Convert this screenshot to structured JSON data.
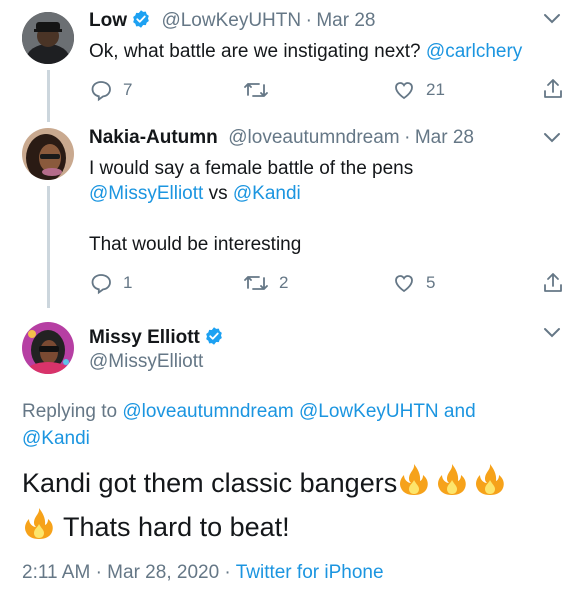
{
  "tweets": [
    {
      "name": "Low",
      "handle": "@LowKeyUHTN",
      "sep": "·",
      "date": "Mar 28",
      "text_prefix": "Ok, what battle are we instigating next? ",
      "mention": "@carlchery",
      "replies": "7",
      "retweets": "",
      "likes": "21"
    },
    {
      "name": "Nakia-Autumn",
      "handle": "@loveautumndream",
      "sep": "·",
      "date": "Mar 28",
      "line1": "I would say a female battle of the pens",
      "mention1": "@MissyElliott",
      "vs": " vs ",
      "mention2": "@Kandi",
      "line3": "That would be interesting",
      "replies": "1",
      "retweets": "2",
      "likes": "5"
    }
  ],
  "main": {
    "name": "Missy Elliott",
    "handle": "@MissyElliott",
    "replying_prefix": "Replying to ",
    "replying_mention1": "@loveautumndream",
    "replying_mention2": "@LowKeyUHTN",
    "replying_and": " and",
    "replying_mention3": "@Kandi",
    "text_line1": "Kandi got them classic bangers",
    "text_line2": "Thats hard to beat!",
    "timestamp": "2:11 AM · Mar 28, 2020 · ",
    "source": "Twitter for iPhone"
  },
  "colors": {
    "link": "#1b95e0",
    "secondary": "#657786",
    "verified": "#1da1f2",
    "thread": "#ccd6dd"
  }
}
